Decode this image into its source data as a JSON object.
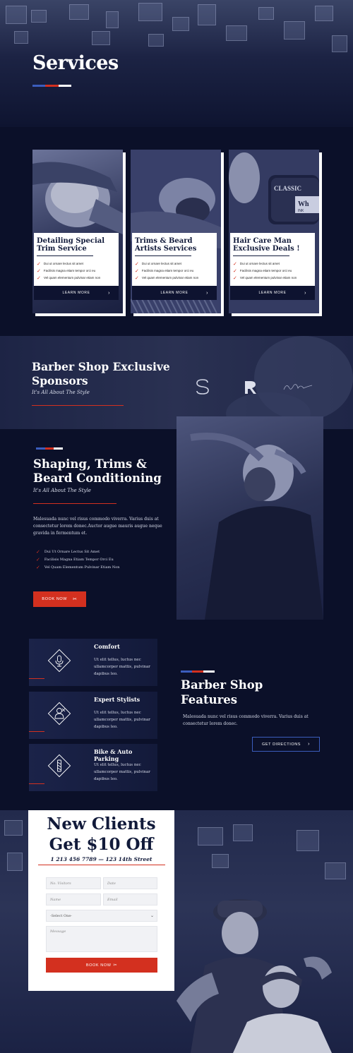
{
  "hero": {
    "title": "Services"
  },
  "services": [
    {
      "title_line1": "Detailing Special",
      "title_line2": "Trim Service",
      "items": [
        "Dui ut ornare lectus sit amet",
        "Facilisis magna etiam tempor orci eu",
        "Vel quam elementum pulvinar etiam non"
      ],
      "button": "LEARN MORE"
    },
    {
      "title_line1": "Trims & Beard",
      "title_line2": "Artists Services",
      "items": [
        "Dui ut ornare lectus sit amet",
        "Facilisis magna etiam tempor orci eu",
        "Vel quam elementum pulvinar etiam non"
      ],
      "button": "LEARN MORE"
    },
    {
      "title_line1": "Hair Care Man",
      "title_line2": "Exclusive Deals !",
      "items": [
        "Dui ut ornare lectus sit amet",
        "Facilisis magna etiam tempor orci eu",
        "Vel quam elementum pulvinar etiam non"
      ],
      "button": "LEARN MORE"
    }
  ],
  "sponsors": {
    "title_line1": "Barber Shop Exclusive",
    "title_line2": "Sponsors",
    "subtitle": "It's All About The Style"
  },
  "shaping": {
    "title_line1": "Shaping, Trims &",
    "title_line2": "Beard Conditioning",
    "subtitle": "It's All About The Style",
    "body": "Malesuada nunc vel risus commodo viverra. Varius duis at consectetur lorem donec.Auctor augue mauris augue neque gravida in fermentum et.",
    "items": [
      "Dui Ut Ornare Lectus Sit Amet",
      "Facilisis Magna Etiam Tempor Orci Eu",
      "Vel Quam Elementum Pulvinar Etiam Non"
    ],
    "button": "BOOK NOW"
  },
  "features": {
    "cards": [
      {
        "title": "Comfort",
        "text": "Ut elit tellus, luctus nec ullamcorper mattis, pulvinar dapibus leo.",
        "icon": "microphone-icon"
      },
      {
        "title": "Expert Stylists",
        "text": "Ut elit tellus, luctus nec ullamcorper mattis, pulvinar dapibus leo.",
        "icon": "stylist-icon"
      },
      {
        "title": "Bike & Auto Parking",
        "text": "Ut elit tellus, luctus nec ullamcorper mattis, pulvinar dapibus leo.",
        "icon": "barber-pole-icon"
      }
    ],
    "title_line1": "Barber Shop",
    "title_line2": "Features",
    "body": "Malesuada nunc vel risus commodo viverra. Varius duis at consectetur lorem donec.",
    "button": "GET DIRECTIONS"
  },
  "offer": {
    "title_line1": "New Clients",
    "title_line2": "Get $10 Off",
    "contact": "1 213 456 7789 — 123 14th Street",
    "placeholders": {
      "visitors": "No. Visitors",
      "date": "Date",
      "name": "Name",
      "email": "Email",
      "select": "-Select One-",
      "message": "Message"
    },
    "button": "BOOK NOW"
  },
  "colors": {
    "navy": "#0b1029",
    "red": "#d3301f",
    "blue": "#3b5dbd",
    "white": "#ffffff"
  }
}
